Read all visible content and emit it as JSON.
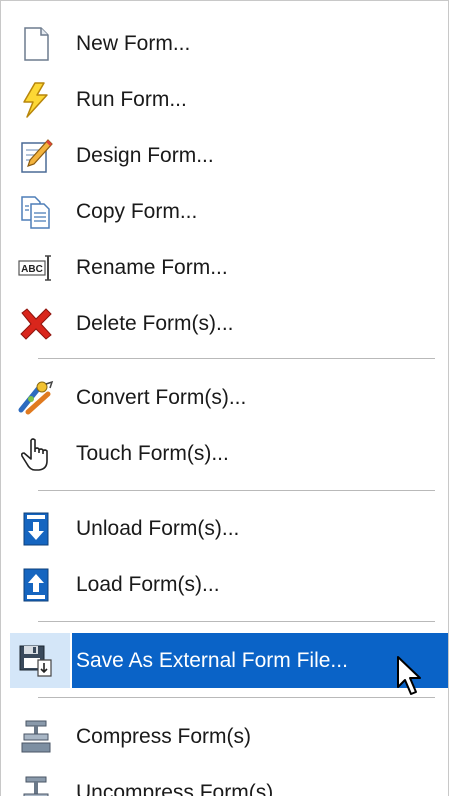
{
  "menu": {
    "items": [
      {
        "label": "New Form...",
        "icon": "new-document-icon"
      },
      {
        "label": "Run Form...",
        "icon": "lightning-bolt-icon"
      },
      {
        "label": "Design Form...",
        "icon": "design-pencil-icon"
      },
      {
        "label": "Copy Form...",
        "icon": "copy-icon"
      },
      {
        "label": "Rename Form...",
        "icon": "rename-abc-icon"
      },
      {
        "label": "Delete Form(s)...",
        "icon": "delete-x-icon"
      },
      {
        "label": "Convert Form(s)...",
        "icon": "convert-icon"
      },
      {
        "label": "Touch Form(s)...",
        "icon": "touch-hand-icon"
      },
      {
        "label": "Unload Form(s)...",
        "icon": "unload-arrow-down-icon"
      },
      {
        "label": "Load Form(s)...",
        "icon": "load-arrow-up-icon"
      },
      {
        "label": "Save As External Form File...",
        "icon": "save-floppy-icon"
      },
      {
        "label": "Compress Form(s)",
        "icon": "compress-clamp-icon"
      },
      {
        "label": "Uncompress Form(s)",
        "icon": "uncompress-clamp-icon"
      }
    ],
    "highlighted": "Save As External Form File..."
  },
  "colors": {
    "highlight": "#0a63c7",
    "highlight_icon_bg": "#d4e6f8",
    "separator": "#b9b9b9",
    "text": "#1a1a1a"
  }
}
